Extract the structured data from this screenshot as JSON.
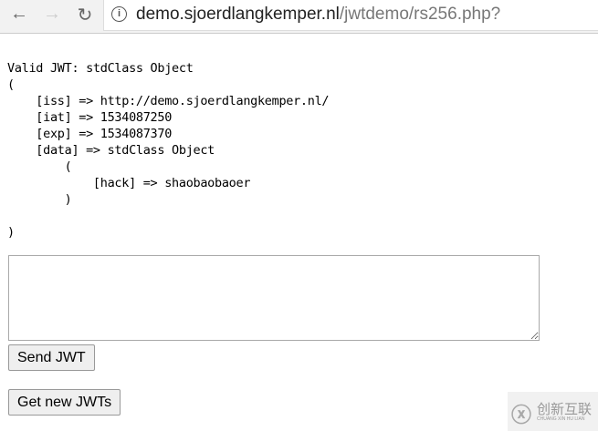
{
  "browser": {
    "url_host": "demo.sjoerdlangkemper.nl",
    "url_path": "/jwtdemo/rs256.php?"
  },
  "output": {
    "lines": [
      "Valid JWT: stdClass Object",
      "(",
      "    [iss] => http://demo.sjoerdlangkemper.nl/",
      "    [iat] => 1534087250",
      "    [exp] => 1534087370",
      "    [data] => stdClass Object",
      "        (",
      "            [hack] => shaobaobaoer",
      "        )",
      "",
      ")"
    ]
  },
  "form": {
    "textarea_value": "",
    "send_label": "Send JWT",
    "new_label": "Get new JWTs"
  },
  "watermark": {
    "cn": "创新互联",
    "en": "CHUANG XIN HU LIAN"
  }
}
